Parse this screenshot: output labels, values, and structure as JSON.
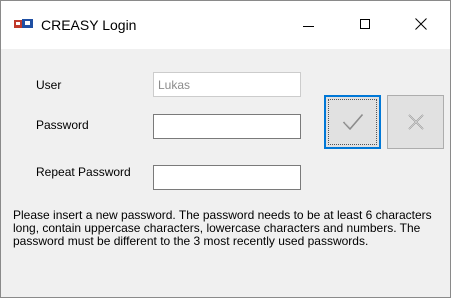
{
  "window": {
    "title": "CREASY Login"
  },
  "form": {
    "user_label": "User",
    "user_value": "Lukas",
    "password_label": "Password",
    "password_value": "",
    "repeat_password_label": "Repeat Password",
    "repeat_password_value": ""
  },
  "buttons": {
    "ok_icon": "checkmark-icon",
    "cancel_icon": "cross-icon"
  },
  "message": "Please insert a new password. The password needs to be at least 6 characters long, contain uppercase characters, lowercase characters and numbers. The password must be different to the 3 most recently used passwords.",
  "colors": {
    "focus_border": "#0078d7",
    "disabled_text": "#8c8c8c",
    "window_bg": "#f0f0f0"
  }
}
